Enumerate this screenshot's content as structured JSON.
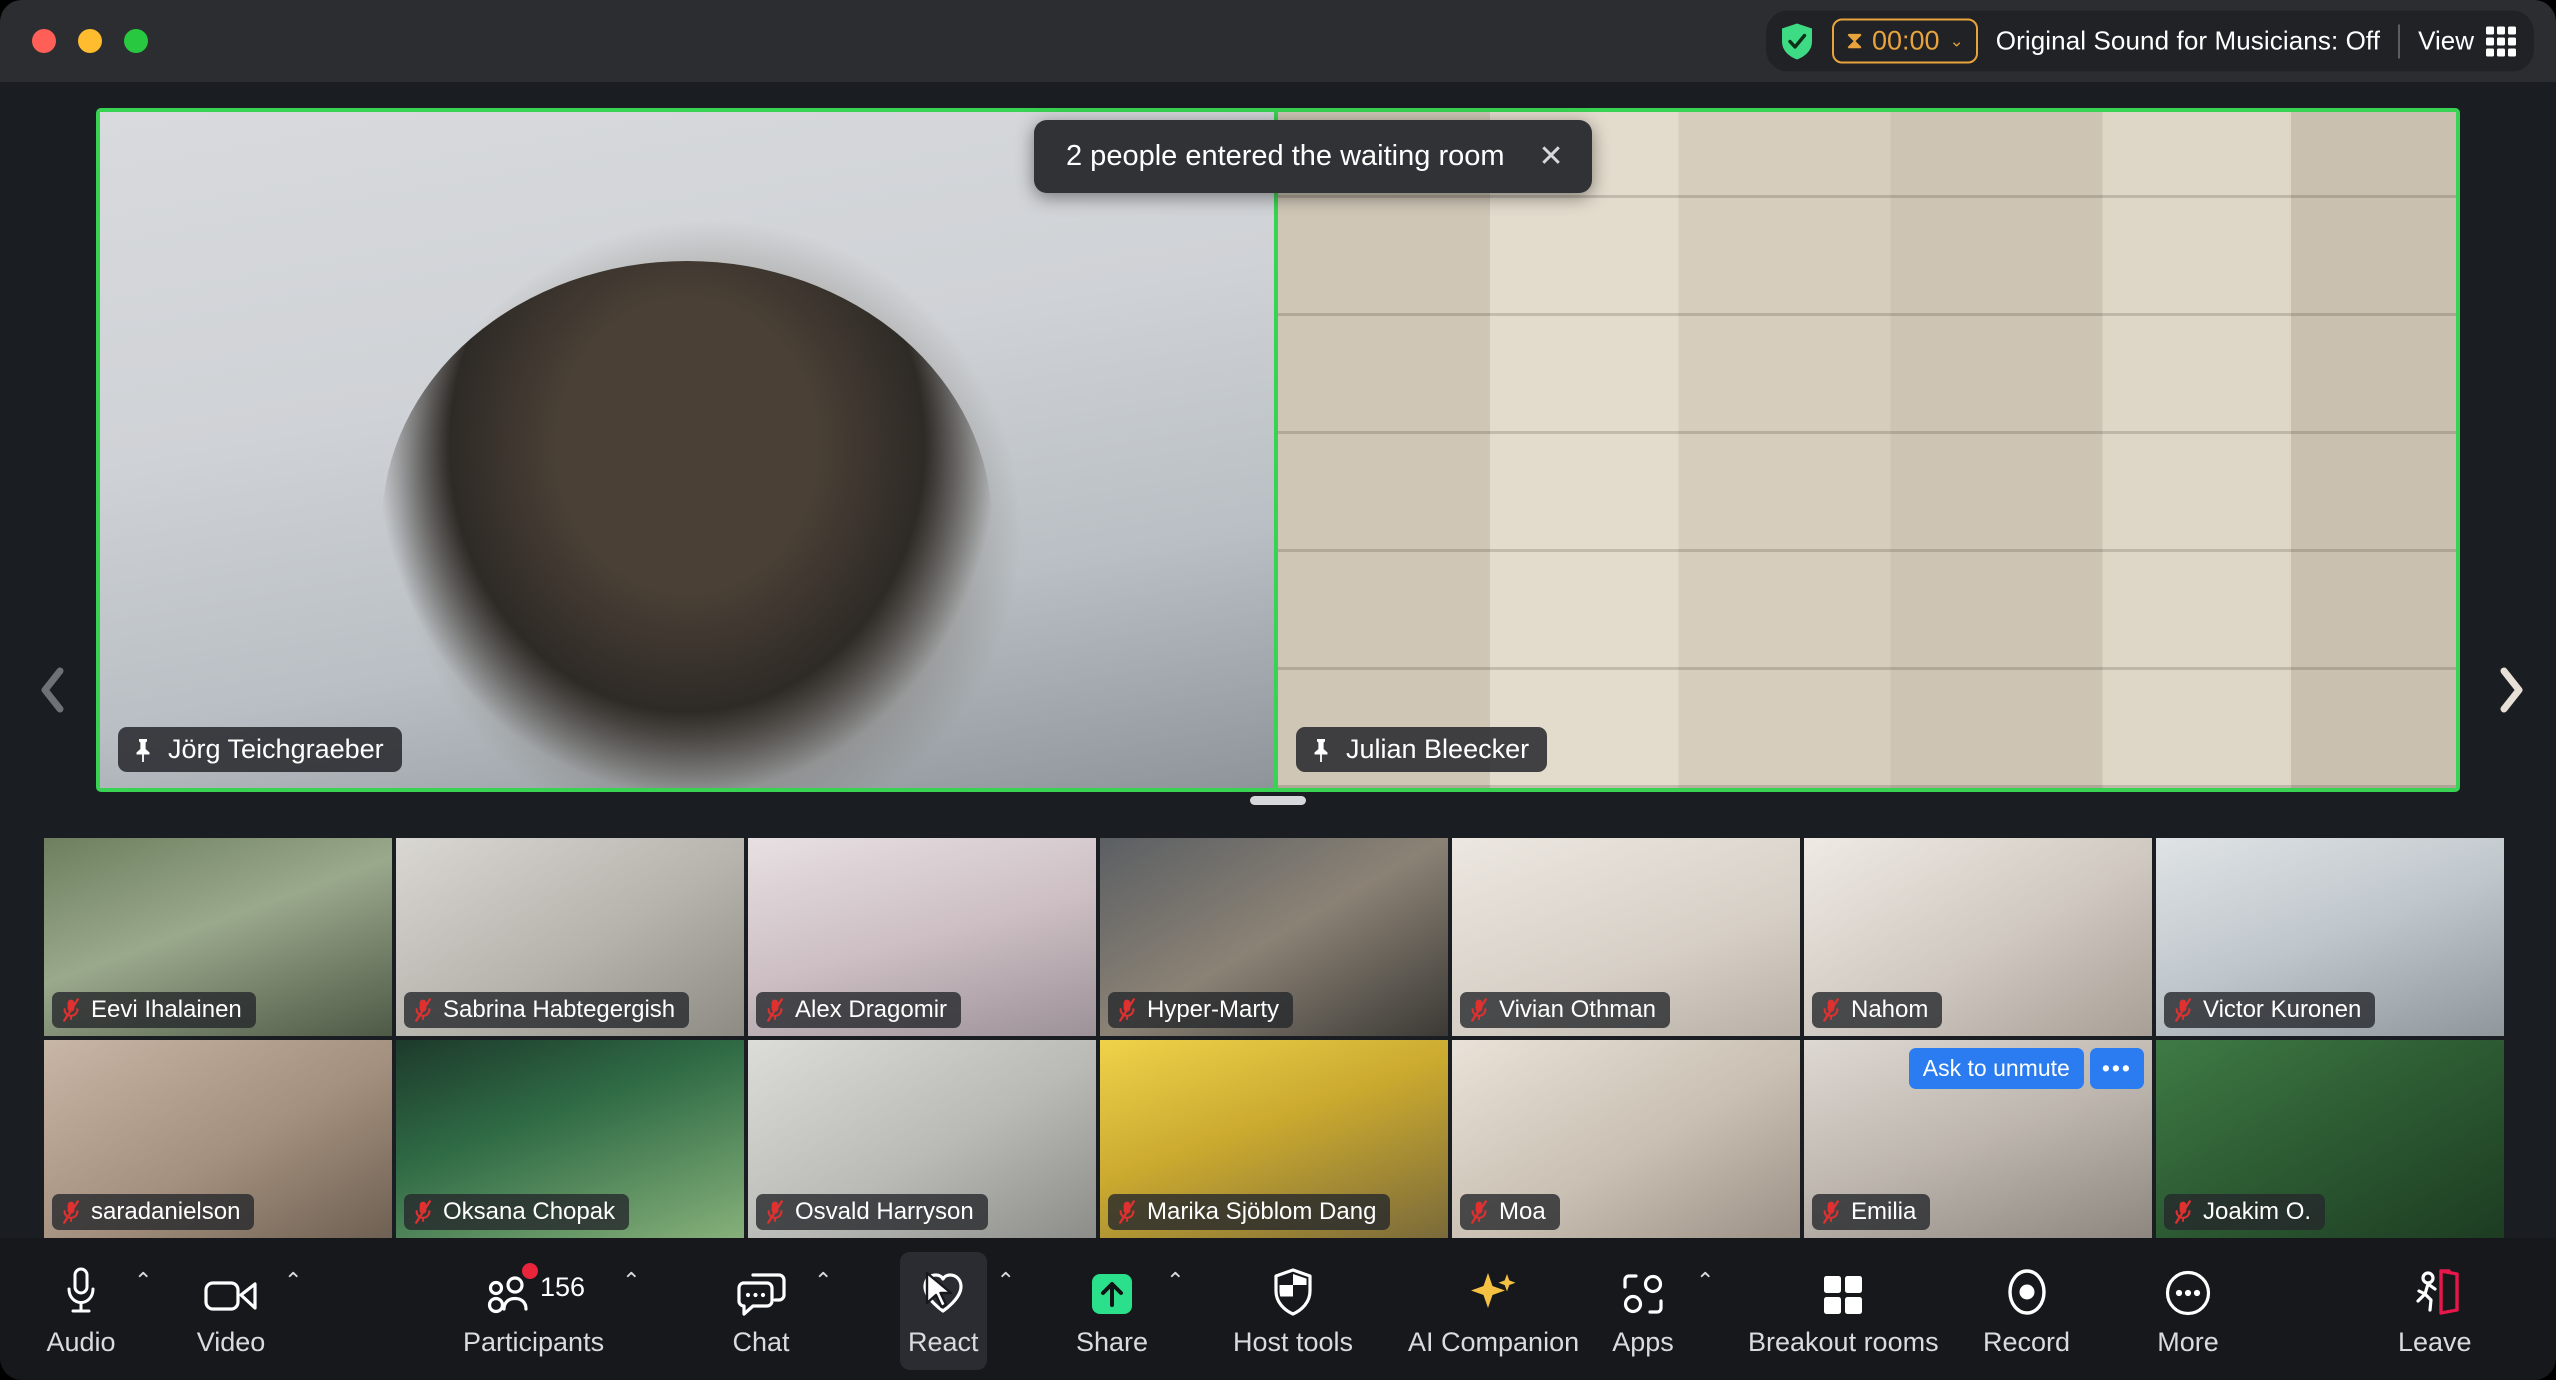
{
  "window": {
    "traffic_lights": [
      "close",
      "minimize",
      "maximize"
    ],
    "colors": {
      "close": "#ff5f57",
      "minimize": "#febc2e",
      "maximize": "#28c840",
      "accent_green": "#39d353",
      "accent_blue": "#2b7cf0",
      "timer_orange": "#e8a33d",
      "leave_red": "#e8174b",
      "ai_gold": "#f5c142",
      "mute_red": "#e03030"
    }
  },
  "titlebar": {
    "encryption_icon": "shield-check-icon",
    "timer": {
      "icon": "hourglass-icon",
      "value": "00:00",
      "chevron": "⌄"
    },
    "original_sound": "Original Sound for Musicians: Off",
    "view_label": "View",
    "view_icon": "grid-view-icon"
  },
  "toast": {
    "message": "2 people entered the waiting room",
    "close_label": "✕"
  },
  "speakers": [
    {
      "name": "Jörg Teichgraeber",
      "pinned": true,
      "active_speaker": true
    },
    {
      "name": "Julian Bleecker",
      "pinned": true,
      "active_speaker": true
    }
  ],
  "thumbnails": {
    "row1": [
      {
        "name": "Eevi Ihalainen",
        "muted": true
      },
      {
        "name": "Sabrina Habtegergish",
        "muted": true
      },
      {
        "name": "Alex Dragomir",
        "muted": true
      },
      {
        "name": "Hyper-Marty",
        "muted": true
      },
      {
        "name": "Vivian Othman",
        "muted": true
      },
      {
        "name": "Nahom",
        "muted": true
      },
      {
        "name": "Victor Kuronen",
        "muted": true
      }
    ],
    "row2": [
      {
        "name": "saradanielson",
        "muted": true
      },
      {
        "name": "Oksana Chopak",
        "muted": true
      },
      {
        "name": "Osvald Harryson",
        "muted": true
      },
      {
        "name": "Marika Sjöblom Dang",
        "muted": true
      },
      {
        "name": "Moa",
        "muted": true
      },
      {
        "name": "Emilia",
        "muted": true,
        "ask_to_unmute": "Ask to unmute",
        "more": "•••"
      },
      {
        "name": "Joakim O.",
        "muted": true
      }
    ]
  },
  "nav": {
    "prev": "‹",
    "next": "›"
  },
  "toolbar": {
    "items": [
      {
        "label": "Audio",
        "icon": "microphone-icon",
        "caret": true,
        "badge": null
      },
      {
        "label": "Video",
        "icon": "video-camera-icon",
        "caret": true,
        "badge": null
      },
      {
        "label": "Participants",
        "icon": "participants-icon",
        "caret": true,
        "badge": "156"
      },
      {
        "label": "Chat",
        "icon": "chat-bubble-icon",
        "caret": true,
        "badge": null
      },
      {
        "label": "React",
        "icon": "heart-react-icon",
        "caret": true,
        "badge": null
      },
      {
        "label": "Share",
        "icon": "share-screen-icon",
        "caret": true,
        "badge": null
      },
      {
        "label": "Host tools",
        "icon": "shield-host-icon",
        "caret": false,
        "badge": null
      },
      {
        "label": "AI Companion",
        "icon": "ai-sparkle-icon",
        "caret": false,
        "badge": null
      },
      {
        "label": "Apps",
        "icon": "apps-icon",
        "caret": true,
        "badge": null
      },
      {
        "label": "Breakout rooms",
        "icon": "breakout-rooms-icon",
        "caret": false,
        "badge": null
      },
      {
        "label": "Record",
        "icon": "record-icon",
        "caret": false,
        "badge": null
      },
      {
        "label": "More",
        "icon": "more-dots-icon",
        "caret": false,
        "badge": null
      },
      {
        "label": "Leave",
        "icon": "leave-door-icon",
        "caret": false,
        "badge": null
      }
    ],
    "caret_glyph": "⌃",
    "active_item": "React"
  }
}
